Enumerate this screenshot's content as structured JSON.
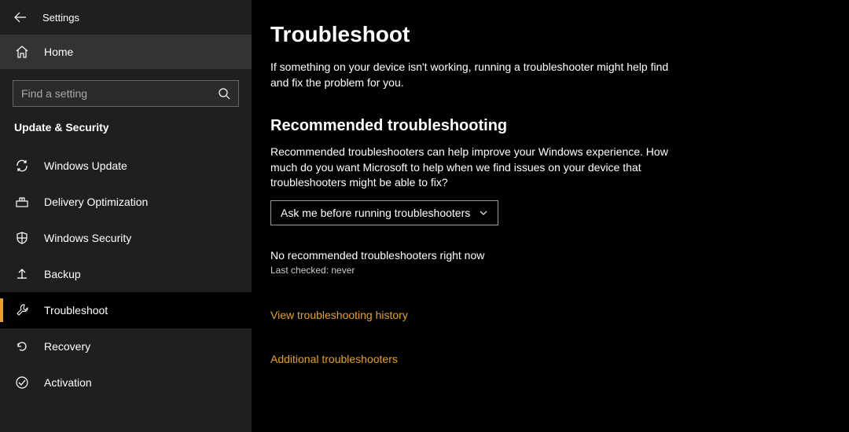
{
  "header": {
    "app_title": "Settings"
  },
  "sidebar": {
    "home_label": "Home",
    "search_placeholder": "Find a setting",
    "section_title": "Update & Security",
    "items": [
      {
        "label": "Windows Update"
      },
      {
        "label": "Delivery Optimization"
      },
      {
        "label": "Windows Security"
      },
      {
        "label": "Backup"
      },
      {
        "label": "Troubleshoot"
      },
      {
        "label": "Recovery"
      },
      {
        "label": "Activation"
      }
    ]
  },
  "main": {
    "title": "Troubleshoot",
    "intro": "If something on your device isn't working, running a troubleshooter might help find and fix the problem for you.",
    "section_heading": "Recommended troubleshooting",
    "section_text": "Recommended troubleshooters can help improve your Windows experience. How much do you want Microsoft to help when we find issues on your device that troubleshooters might be able to fix?",
    "dropdown_value": "Ask me before running troubleshooters",
    "status": "No recommended troubleshooters right now",
    "last_checked": "Last checked: never",
    "link_history": "View troubleshooting history",
    "link_additional": "Additional troubleshooters"
  }
}
